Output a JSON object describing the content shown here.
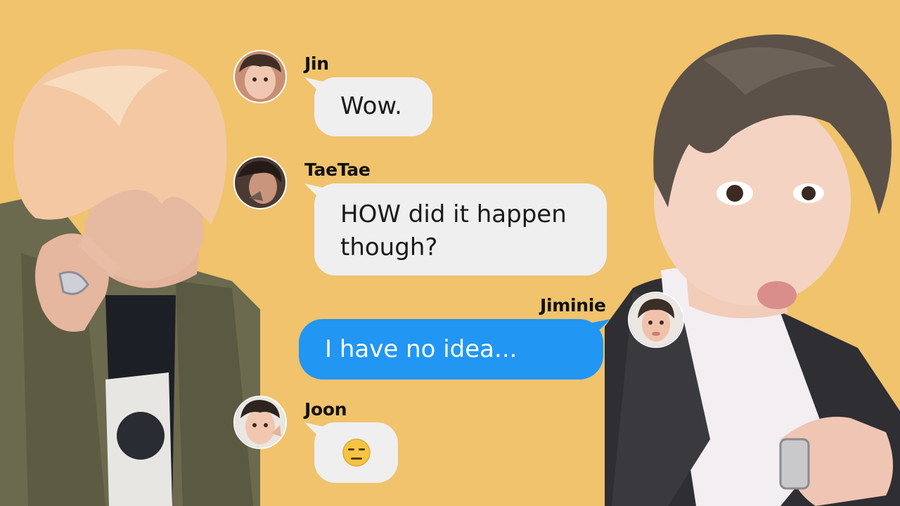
{
  "background_color": "#f0c36c",
  "photos": [
    {
      "side": "left",
      "icon": "person-photo-peach-hair"
    },
    {
      "side": "right",
      "icon": "person-photo-dark-hair-suit"
    }
  ],
  "messages": [
    {
      "sender": "Jin",
      "direction": "incoming",
      "lines": [
        "Wow."
      ],
      "avatar_icon": "jin-avatar"
    },
    {
      "sender": "TaeTae",
      "direction": "incoming",
      "lines": [
        "HOW did it happen",
        "though?"
      ],
      "avatar_icon": "taetae-avatar"
    },
    {
      "sender": "Jiminie",
      "direction": "outgoing",
      "lines": [
        "I have no idea..."
      ],
      "avatar_icon": "jiminie-avatar"
    },
    {
      "sender": "Joon",
      "direction": "incoming",
      "lines": [
        "😑"
      ],
      "avatar_icon": "joon-avatar"
    }
  ],
  "colors": {
    "incoming_bubble": "#efefef",
    "outgoing_bubble": "#2196f3"
  }
}
